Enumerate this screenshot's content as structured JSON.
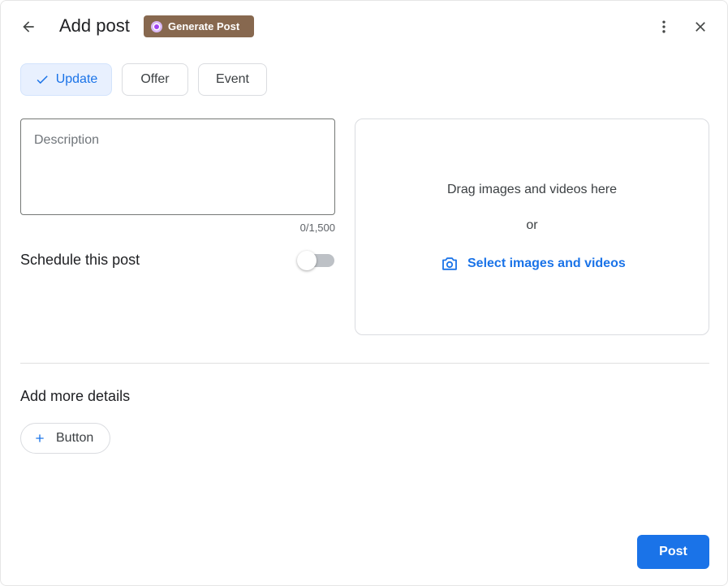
{
  "header": {
    "title": "Add post",
    "generate_label": "Generate Post",
    "back_icon": "arrow-left-icon",
    "more_icon": "more-vertical-icon",
    "close_icon": "close-icon"
  },
  "tabs": [
    {
      "label": "Update",
      "selected": true
    },
    {
      "label": "Offer",
      "selected": false
    },
    {
      "label": "Event",
      "selected": false
    }
  ],
  "description": {
    "placeholder": "Description",
    "value": "",
    "counter": "0/1,500"
  },
  "schedule": {
    "label": "Schedule this post",
    "enabled": false
  },
  "media": {
    "drag_text": "Drag images and videos here",
    "or_text": "or",
    "select_label": "Select images and videos",
    "select_icon": "camera-icon"
  },
  "details": {
    "title": "Add more details",
    "button_label": "Button"
  },
  "footer": {
    "post_label": "Post"
  },
  "colors": {
    "accent": "#1a73e8",
    "generate_bg": "#87684f",
    "selected_tab_bg": "#e8f0fe"
  }
}
